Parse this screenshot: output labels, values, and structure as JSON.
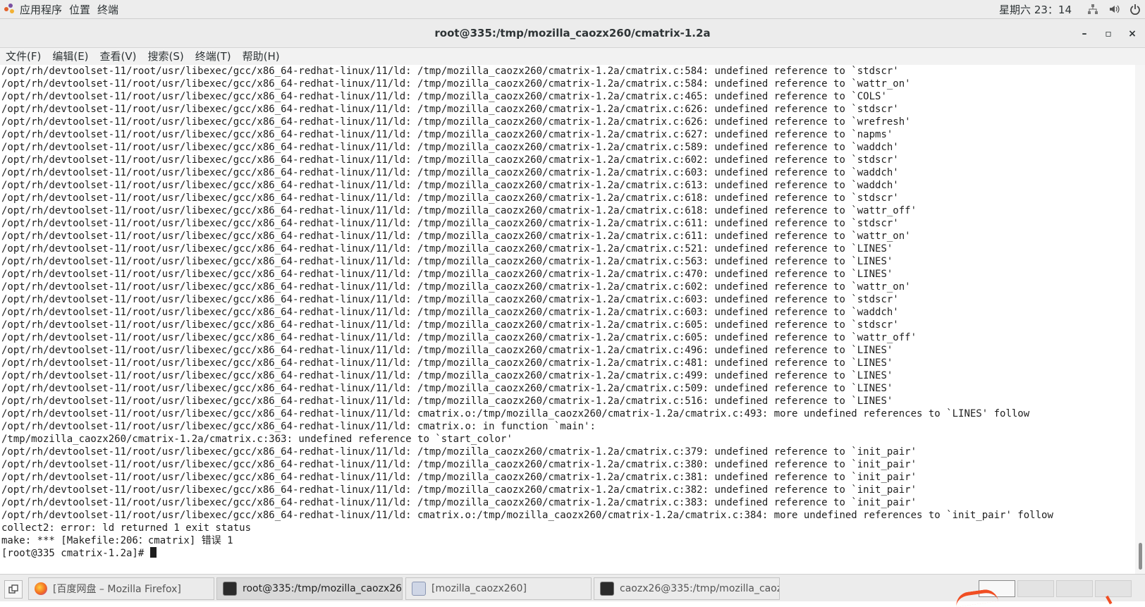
{
  "top_panel": {
    "applications": "应用程序",
    "places": "位置",
    "terminal": "终端",
    "clock": "星期六 23：14",
    "icons": [
      "network-icon",
      "volume-icon",
      "power-icon"
    ]
  },
  "window": {
    "title": "root@335:/tmp/mozilla_caozx260/cmatrix-1.2a",
    "controls": {
      "minimize": "–",
      "maximize": "▫",
      "close": "×"
    }
  },
  "menubar": {
    "items": [
      "文件(F)",
      "编辑(E)",
      "查看(V)",
      "搜索(S)",
      "终端(T)",
      "帮助(H)"
    ]
  },
  "terminal": {
    "lines": [
      "/opt/rh/devtoolset-11/root/usr/libexec/gcc/x86_64-redhat-linux/11/ld: /tmp/mozilla_caozx260/cmatrix-1.2a/cmatrix.c:584: undefined reference to `stdscr'",
      "/opt/rh/devtoolset-11/root/usr/libexec/gcc/x86_64-redhat-linux/11/ld: /tmp/mozilla_caozx260/cmatrix-1.2a/cmatrix.c:584: undefined reference to `wattr_on'",
      "/opt/rh/devtoolset-11/root/usr/libexec/gcc/x86_64-redhat-linux/11/ld: /tmp/mozilla_caozx260/cmatrix-1.2a/cmatrix.c:465: undefined reference to `COLS'",
      "/opt/rh/devtoolset-11/root/usr/libexec/gcc/x86_64-redhat-linux/11/ld: /tmp/mozilla_caozx260/cmatrix-1.2a/cmatrix.c:626: undefined reference to `stdscr'",
      "/opt/rh/devtoolset-11/root/usr/libexec/gcc/x86_64-redhat-linux/11/ld: /tmp/mozilla_caozx260/cmatrix-1.2a/cmatrix.c:626: undefined reference to `wrefresh'",
      "/opt/rh/devtoolset-11/root/usr/libexec/gcc/x86_64-redhat-linux/11/ld: /tmp/mozilla_caozx260/cmatrix-1.2a/cmatrix.c:627: undefined reference to `napms'",
      "/opt/rh/devtoolset-11/root/usr/libexec/gcc/x86_64-redhat-linux/11/ld: /tmp/mozilla_caozx260/cmatrix-1.2a/cmatrix.c:589: undefined reference to `waddch'",
      "/opt/rh/devtoolset-11/root/usr/libexec/gcc/x86_64-redhat-linux/11/ld: /tmp/mozilla_caozx260/cmatrix-1.2a/cmatrix.c:602: undefined reference to `stdscr'",
      "/opt/rh/devtoolset-11/root/usr/libexec/gcc/x86_64-redhat-linux/11/ld: /tmp/mozilla_caozx260/cmatrix-1.2a/cmatrix.c:603: undefined reference to `waddch'",
      "/opt/rh/devtoolset-11/root/usr/libexec/gcc/x86_64-redhat-linux/11/ld: /tmp/mozilla_caozx260/cmatrix-1.2a/cmatrix.c:613: undefined reference to `waddch'",
      "/opt/rh/devtoolset-11/root/usr/libexec/gcc/x86_64-redhat-linux/11/ld: /tmp/mozilla_caozx260/cmatrix-1.2a/cmatrix.c:618: undefined reference to `stdscr'",
      "/opt/rh/devtoolset-11/root/usr/libexec/gcc/x86_64-redhat-linux/11/ld: /tmp/mozilla_caozx260/cmatrix-1.2a/cmatrix.c:618: undefined reference to `wattr_off'",
      "/opt/rh/devtoolset-11/root/usr/libexec/gcc/x86_64-redhat-linux/11/ld: /tmp/mozilla_caozx260/cmatrix-1.2a/cmatrix.c:611: undefined reference to `stdscr'",
      "/opt/rh/devtoolset-11/root/usr/libexec/gcc/x86_64-redhat-linux/11/ld: /tmp/mozilla_caozx260/cmatrix-1.2a/cmatrix.c:611: undefined reference to `wattr_on'",
      "/opt/rh/devtoolset-11/root/usr/libexec/gcc/x86_64-redhat-linux/11/ld: /tmp/mozilla_caozx260/cmatrix-1.2a/cmatrix.c:521: undefined reference to `LINES'",
      "/opt/rh/devtoolset-11/root/usr/libexec/gcc/x86_64-redhat-linux/11/ld: /tmp/mozilla_caozx260/cmatrix-1.2a/cmatrix.c:563: undefined reference to `LINES'",
      "/opt/rh/devtoolset-11/root/usr/libexec/gcc/x86_64-redhat-linux/11/ld: /tmp/mozilla_caozx260/cmatrix-1.2a/cmatrix.c:470: undefined reference to `LINES'",
      "/opt/rh/devtoolset-11/root/usr/libexec/gcc/x86_64-redhat-linux/11/ld: /tmp/mozilla_caozx260/cmatrix-1.2a/cmatrix.c:602: undefined reference to `wattr_on'",
      "/opt/rh/devtoolset-11/root/usr/libexec/gcc/x86_64-redhat-linux/11/ld: /tmp/mozilla_caozx260/cmatrix-1.2a/cmatrix.c:603: undefined reference to `stdscr'",
      "/opt/rh/devtoolset-11/root/usr/libexec/gcc/x86_64-redhat-linux/11/ld: /tmp/mozilla_caozx260/cmatrix-1.2a/cmatrix.c:603: undefined reference to `waddch'",
      "/opt/rh/devtoolset-11/root/usr/libexec/gcc/x86_64-redhat-linux/11/ld: /tmp/mozilla_caozx260/cmatrix-1.2a/cmatrix.c:605: undefined reference to `stdscr'",
      "/opt/rh/devtoolset-11/root/usr/libexec/gcc/x86_64-redhat-linux/11/ld: /tmp/mozilla_caozx260/cmatrix-1.2a/cmatrix.c:605: undefined reference to `wattr_off'",
      "/opt/rh/devtoolset-11/root/usr/libexec/gcc/x86_64-redhat-linux/11/ld: /tmp/mozilla_caozx260/cmatrix-1.2a/cmatrix.c:496: undefined reference to `LINES'",
      "/opt/rh/devtoolset-11/root/usr/libexec/gcc/x86_64-redhat-linux/11/ld: /tmp/mozilla_caozx260/cmatrix-1.2a/cmatrix.c:481: undefined reference to `LINES'",
      "/opt/rh/devtoolset-11/root/usr/libexec/gcc/x86_64-redhat-linux/11/ld: /tmp/mozilla_caozx260/cmatrix-1.2a/cmatrix.c:499: undefined reference to `LINES'",
      "/opt/rh/devtoolset-11/root/usr/libexec/gcc/x86_64-redhat-linux/11/ld: /tmp/mozilla_caozx260/cmatrix-1.2a/cmatrix.c:509: undefined reference to `LINES'",
      "/opt/rh/devtoolset-11/root/usr/libexec/gcc/x86_64-redhat-linux/11/ld: /tmp/mozilla_caozx260/cmatrix-1.2a/cmatrix.c:516: undefined reference to `LINES'",
      "/opt/rh/devtoolset-11/root/usr/libexec/gcc/x86_64-redhat-linux/11/ld: cmatrix.o:/tmp/mozilla_caozx260/cmatrix-1.2a/cmatrix.c:493: more undefined references to `LINES' follow",
      "/opt/rh/devtoolset-11/root/usr/libexec/gcc/x86_64-redhat-linux/11/ld: cmatrix.o: in function `main':",
      "/tmp/mozilla_caozx260/cmatrix-1.2a/cmatrix.c:363: undefined reference to `start_color'",
      "/opt/rh/devtoolset-11/root/usr/libexec/gcc/x86_64-redhat-linux/11/ld: /tmp/mozilla_caozx260/cmatrix-1.2a/cmatrix.c:379: undefined reference to `init_pair'",
      "/opt/rh/devtoolset-11/root/usr/libexec/gcc/x86_64-redhat-linux/11/ld: /tmp/mozilla_caozx260/cmatrix-1.2a/cmatrix.c:380: undefined reference to `init_pair'",
      "/opt/rh/devtoolset-11/root/usr/libexec/gcc/x86_64-redhat-linux/11/ld: /tmp/mozilla_caozx260/cmatrix-1.2a/cmatrix.c:381: undefined reference to `init_pair'",
      "/opt/rh/devtoolset-11/root/usr/libexec/gcc/x86_64-redhat-linux/11/ld: /tmp/mozilla_caozx260/cmatrix-1.2a/cmatrix.c:382: undefined reference to `init_pair'",
      "/opt/rh/devtoolset-11/root/usr/libexec/gcc/x86_64-redhat-linux/11/ld: /tmp/mozilla_caozx260/cmatrix-1.2a/cmatrix.c:383: undefined reference to `init_pair'",
      "/opt/rh/devtoolset-11/root/usr/libexec/gcc/x86_64-redhat-linux/11/ld: cmatrix.o:/tmp/mozilla_caozx260/cmatrix-1.2a/cmatrix.c:384: more undefined references to `init_pair' follow",
      "collect2: error: ld returned 1 exit status",
      "make: *** [Makefile:206：cmatrix] 错误 1"
    ],
    "prompt": "[root@335 cmatrix-1.2a]# "
  },
  "taskbar": {
    "tasks": [
      {
        "label": "[百度网盘 – Mozilla Firefox]",
        "icon": "firefox-icon"
      },
      {
        "label": "root@335:/tmp/mozilla_caozx260/···",
        "icon": "terminal-icon"
      },
      {
        "label": "[mozilla_caozx260]",
        "icon": "file-manager-icon"
      },
      {
        "label": "caozx26@335:/tmp/mozilla_caozx···",
        "icon": "terminal-icon"
      }
    ],
    "workspaces": 4,
    "active_workspace": 1
  }
}
